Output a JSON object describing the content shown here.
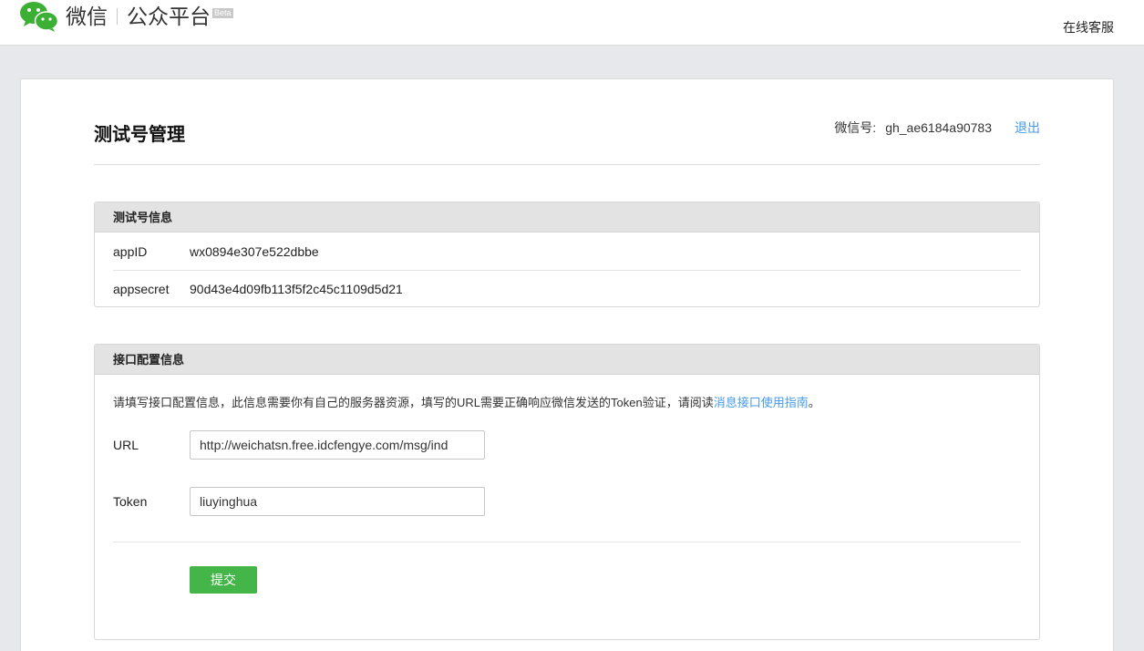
{
  "header": {
    "brand_name": "微信",
    "brand_platform": "公众平台",
    "beta_badge": "Beta",
    "service_link": "在线客服"
  },
  "page": {
    "title": "测试号管理",
    "account_label": "微信号:",
    "account_value": "gh_ae6184a90783",
    "logout": "退出"
  },
  "test_info": {
    "heading": "测试号信息",
    "rows": [
      {
        "label": "appID",
        "value": "wx0894e307e522dbbe"
      },
      {
        "label": "appsecret",
        "value": "90d43e4d09fb113f5f2c45c1109d5d21"
      }
    ]
  },
  "api_config": {
    "heading": "接口配置信息",
    "description_prefix": "请填写接口配置信息，此信息需要你有自己的服务器资源，填写的URL需要正确响应微信发送的Token验证，请阅读",
    "description_link": "消息接口使用指南",
    "description_suffix": "。",
    "url_label": "URL",
    "url_value": "http://weichatsn.free.idcfengye.com/msg/ind",
    "token_label": "Token",
    "token_value": "liuyinghua",
    "submit": "提交"
  },
  "colors": {
    "accent_link": "#459ae9",
    "submit_green": "#44b549",
    "logo_green": "#3cb034"
  }
}
